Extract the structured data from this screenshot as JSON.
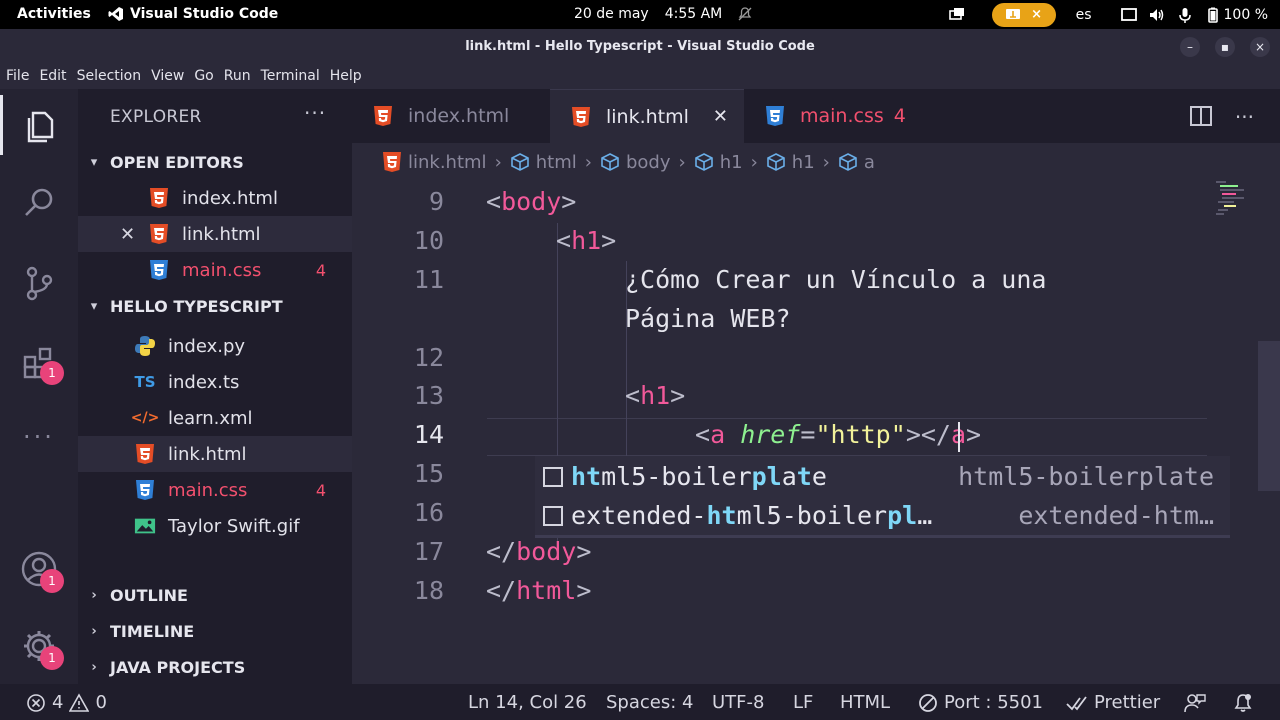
{
  "topbar": {
    "activities": "Activities",
    "app_name": "Visual Studio Code",
    "date": "20 de may",
    "time": "4:55 AM",
    "pill_close": "×",
    "language": "es",
    "battery": "100 %"
  },
  "window": {
    "title": "link.html - Hello Typescript - Visual Studio Code",
    "minimize": "–",
    "maximize": "▪",
    "close": "×"
  },
  "menu": [
    "File",
    "Edit",
    "Selection",
    "View",
    "Go",
    "Run",
    "Terminal",
    "Help"
  ],
  "activity": {
    "extensions_badge": "1",
    "accounts_badge": "1",
    "settings_badge": "1"
  },
  "sidebar": {
    "header": "EXPLORER",
    "more": "···",
    "open_editors_title": "OPEN EDITORS",
    "open_editors": [
      {
        "name": "index.html",
        "count": ""
      },
      {
        "name": "link.html",
        "count": ""
      },
      {
        "name": "main.css",
        "count": "4"
      }
    ],
    "project_title": "HELLO TYPESCRIPT",
    "files": [
      {
        "name": "index.py",
        "count": ""
      },
      {
        "name": "index.ts",
        "count": ""
      },
      {
        "name": "learn.xml",
        "count": ""
      },
      {
        "name": "link.html",
        "count": ""
      },
      {
        "name": "main.css",
        "count": "4"
      },
      {
        "name": "Taylor Swift.gif",
        "count": ""
      }
    ],
    "ts_glyph": "TS",
    "xml_glyph": "</>",
    "close_x": "✕",
    "outline": "OUTLINE",
    "timeline": "TIMELINE",
    "java_projects": "JAVA PROJECTS"
  },
  "tabs": [
    {
      "label": "index.html",
      "count": ""
    },
    {
      "label": "link.html",
      "close": "✕"
    },
    {
      "label": "main.css",
      "count": "4"
    }
  ],
  "breadcrumbs": [
    "link.html",
    "html",
    "body",
    "h1",
    "h1",
    "a"
  ],
  "editor": {
    "line_numbers": [
      "9",
      "10",
      "11",
      "",
      "12",
      "13",
      "14",
      "15",
      "16",
      "17",
      "18"
    ],
    "lines": {
      "l9": {
        "open": "<",
        "tag": "body",
        "close": ">"
      },
      "l10": {
        "open": "<",
        "tag": "h1",
        "close": ">"
      },
      "l11a": "¿Cómo Crear un Vínculo a una",
      "l11b": "Página WEB?",
      "l13": {
        "open": "<",
        "tag": "h1",
        "close": ">"
      },
      "l14": {
        "open": "<",
        "tag": "a",
        "attr": "href",
        "eq": "=",
        "q1": "\"",
        "str": "http",
        "q2": "\"",
        "gt": ">",
        "endopen": "</",
        "endtag": "a",
        "endclose": ">"
      },
      "l17": {
        "open": "</",
        "tag": "body",
        "close": ">"
      },
      "l18": {
        "open": "</",
        "tag": "html",
        "close": ">"
      }
    },
    "suggestions": [
      {
        "pre": "",
        "h1": "ht",
        "mid1": "ml5-boiler",
        "h2": "pl",
        "mid2": "a",
        "h3": "t",
        "rest": "e",
        "detail": "html5-boilerplate"
      },
      {
        "pre": "extended-",
        "h1": "ht",
        "mid1": "ml5-boiler",
        "h2": "pl",
        "mid2": "",
        "h3": "",
        "rest": "…",
        "detail": "extended-htm…"
      }
    ]
  },
  "status": {
    "errors": "4",
    "warnings": "0",
    "position": "Ln 14, Col 26",
    "spaces": "Spaces: 4",
    "encoding": "UTF-8",
    "eol": "LF",
    "language": "HTML",
    "port": "Port : 5501",
    "prettier": "Prettier"
  },
  "colors": {
    "html_icon": "#e44d26",
    "css_icon": "#2f7fd6",
    "error_red": "#f2506e",
    "tag_pink": "#f2599a",
    "attr_green": "#8ef090",
    "string_yellow": "#f2f29a",
    "badge_pink": "#e8437a",
    "pill_orange": "#e8a317"
  }
}
